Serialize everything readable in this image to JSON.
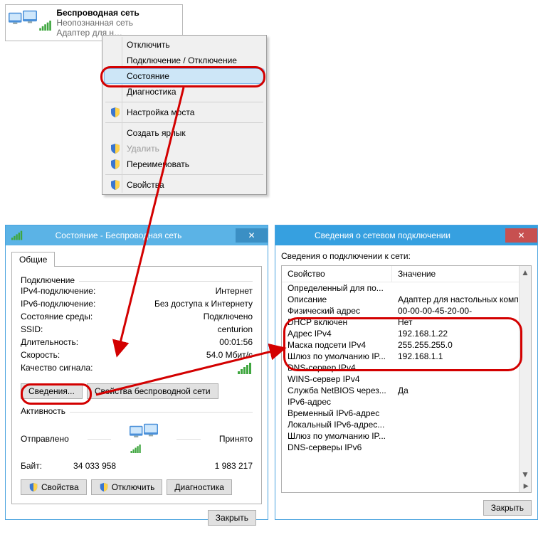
{
  "tooltip": {
    "title": "Беспроводная сеть",
    "line2": "Неопознанная сеть",
    "line3": "Адаптер для н…"
  },
  "menu": {
    "items": [
      {
        "label": "Отключить",
        "shield": false,
        "disabled": false
      },
      {
        "label": "Подключение / Отключение",
        "shield": false,
        "disabled": false
      },
      {
        "label": "Состояние",
        "shield": false,
        "disabled": false,
        "hl": true
      },
      {
        "label": "Диагностика",
        "shield": false,
        "disabled": false
      },
      {
        "label": "Настройка моста",
        "shield": true,
        "disabled": false
      },
      {
        "label": "Создать ярлык",
        "shield": false,
        "disabled": false
      },
      {
        "label": "Удалить",
        "shield": true,
        "disabled": true
      },
      {
        "label": "Переименовать",
        "shield": true,
        "disabled": false
      },
      {
        "label": "Свойства",
        "shield": true,
        "disabled": false
      }
    ]
  },
  "status": {
    "title": "Состояние - Беспроводная сеть",
    "tab": "Общие",
    "group_connection": "Подключение",
    "rows": {
      "ipv4_k": "IPv4-подключение:",
      "ipv4_v": "Интернет",
      "ipv6_k": "IPv6-подключение:",
      "ipv6_v": "Без доступа к Интернету",
      "media_k": "Состояние среды:",
      "media_v": "Подключено",
      "ssid_k": "SSID:",
      "ssid_v": "centurion",
      "dur_k": "Длительность:",
      "dur_v": "00:01:56",
      "speed_k": "Скорость:",
      "speed_v": "54.0 Мбит/с",
      "sig_k": "Качество сигнала:"
    },
    "btn_details": "Сведения...",
    "btn_wprops": "Свойства беспроводной сети",
    "group_activity": "Активность",
    "activity": {
      "sent_label": "Отправлено",
      "recv_label": "Принято",
      "bytes_label": "Байт:",
      "sent": "34 033 958",
      "recv": "1 983 217"
    },
    "btn_props": "Свойства",
    "btn_disable": "Отключить",
    "btn_diag": "Диагностика",
    "btn_close": "Закрыть"
  },
  "details": {
    "title": "Сведения о сетевом подключении",
    "label": "Сведения о подключении к сети:",
    "col1": "Свойство",
    "col2": "Значение",
    "rows": [
      {
        "k": "Определенный для по...",
        "v": ""
      },
      {
        "k": "Описание",
        "v": "Адаптер для настольных компьюте"
      },
      {
        "k": "Физический адрес",
        "v": "00-00-00-45-20-00-"
      },
      {
        "k": "DHCP включен",
        "v": "Нет"
      },
      {
        "k": "Адрес IPv4",
        "v": "192.168.1.22"
      },
      {
        "k": "Маска подсети IPv4",
        "v": "255.255.255.0"
      },
      {
        "k": "Шлюз по умолчанию IP...",
        "v": "192.168.1.1"
      },
      {
        "k": "DNS-сервер IPv4",
        "v": ""
      },
      {
        "k": "WINS-сервер IPv4",
        "v": ""
      },
      {
        "k": "Служба NetBIOS через...",
        "v": "Да"
      },
      {
        "k": "IPv6-адрес",
        "v": ""
      },
      {
        "k": "Временный IPv6-адрес",
        "v": ""
      },
      {
        "k": "Локальный IPv6-адрес...",
        "v": ""
      },
      {
        "k": "Шлюз по умолчанию IP...",
        "v": ""
      },
      {
        "k": "DNS-серверы IPv6",
        "v": ""
      }
    ],
    "btn_close": "Закрыть"
  }
}
